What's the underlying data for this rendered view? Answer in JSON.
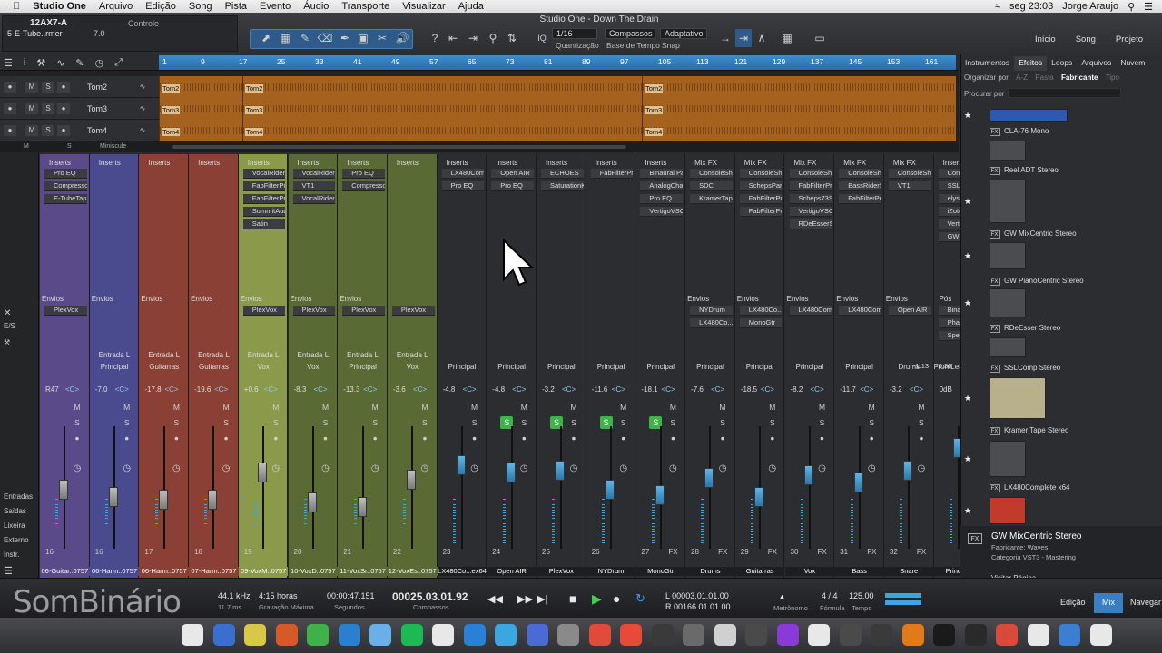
{
  "menubar": {
    "app": "Studio One",
    "items": [
      "Arquivo",
      "Edição",
      "Song",
      "Pista",
      "Evento",
      "Áudio",
      "Transporte",
      "Visualizar",
      "Ajuda"
    ],
    "clock": "seg 23:03",
    "user": "Jorge Araujo"
  },
  "window_title": "Studio One - Down The Drain",
  "instrument": {
    "name": "12AX7-A",
    "preset": "5-E-Tube..rmer",
    "value": "7.0",
    "control_label": "Controle"
  },
  "toolbar": {
    "quantize_value": "1/16",
    "quantize_label": "Quantização",
    "timebase_value": "Compassos",
    "timebase_label": "Base de Tempo",
    "snap_value": "Adaptativo",
    "snap_label": "Snap",
    "iq": "IQ"
  },
  "top_nav": [
    "Início",
    "Song",
    "Projeto"
  ],
  "ruler_ticks": [
    "1",
    "9",
    "17",
    "25",
    "33",
    "41",
    "49",
    "57",
    "65",
    "73",
    "81",
    "89",
    "97",
    "105",
    "113",
    "121",
    "129",
    "137",
    "145",
    "153",
    "161"
  ],
  "tracks": [
    {
      "name": "Tom2",
      "m": "M",
      "s": "S",
      "clips": [
        "Tom2",
        "Tom2",
        "Tom2"
      ]
    },
    {
      "name": "Tom3",
      "m": "M",
      "s": "S",
      "clips": [
        "Tom3",
        "Tom3",
        "Tom3"
      ]
    },
    {
      "name": "Tom4",
      "m": "M",
      "s": "S",
      "clips": [
        "Tom4",
        "Tom4",
        "Tom4"
      ]
    }
  ],
  "arranger_footer": {
    "m": "M",
    "s": "S",
    "miniscule": "Miniscule"
  },
  "mixer_left": {
    "es": "E/S",
    "items": [
      "Entradas",
      "Saídas",
      "Lixeira",
      "Externo",
      "Instr."
    ]
  },
  "inserts_label": "Inserts",
  "sends_label": "Envios",
  "mixfx_label": "Mix FX",
  "pos_label": "Pós",
  "strips": [
    {
      "route_in": "",
      "route_out": "",
      "vol": "R47",
      "name": "06-Guitar..0757",
      "num": "16",
      "color": "#5a4a8a",
      "inserts": [
        "Pro EQ",
        "Compressor",
        "E-TubeTap..."
      ],
      "sends": [
        "PlexVox"
      ]
    },
    {
      "route_in": "Entrada L",
      "route_out": "Principal",
      "vol": "-7.0",
      "name": "06-Harm..0757",
      "num": "16",
      "color": "#4a4a8e",
      "inserts": [],
      "sends": []
    },
    {
      "route_in": "Entrada L",
      "route_out": "Guitarras",
      "vol": "-17.8",
      "name": "06-Harm..0757",
      "num": "17",
      "color": "#8a4034",
      "inserts": [],
      "sends": []
    },
    {
      "route_in": "Entrada L",
      "route_out": "Guitarras",
      "vol": "-19.6",
      "name": "07-Harm..0757",
      "num": "18",
      "color": "#8a4034",
      "inserts": [],
      "sends": []
    },
    {
      "route_in": "Entrada L",
      "route_out": "Vox",
      "vol": "+0.6",
      "name": "09-VoxM..0757",
      "num": "19",
      "color": "#8a9a4a",
      "inserts": [
        "VocalRider...",
        "FabFilterPr...",
        "FabFilterPr...",
        "SummitAud...",
        "Satin"
      ],
      "sends": [
        "PlexVox"
      ]
    },
    {
      "route_in": "Entrada L",
      "route_out": "Vox",
      "vol": "-8.3",
      "name": "10-VoxD..0757",
      "num": "20",
      "color": "#5a6a34",
      "inserts": [
        "VocalRider...",
        "VT1",
        "VocalRider..."
      ],
      "sends": [
        "PlexVox"
      ]
    },
    {
      "route_in": "Entrada L",
      "route_out": "Principal",
      "vol": "-13.3",
      "name": "11-VoxSr..0757",
      "num": "21",
      "color": "#5a6a34",
      "inserts": [
        "Pro EQ",
        "Compressor"
      ],
      "sends": [
        "PlexVox"
      ]
    },
    {
      "route_in": "Entrada L",
      "route_out": "Vox",
      "vol": "-3.6",
      "name": "12-VoxEs..0757",
      "num": "22",
      "color": "#5a6a34",
      "inserts": [],
      "sends": [
        "PlexVox"
      ]
    },
    {
      "route_in": "",
      "route_out": "Principal",
      "vol": "-4.8",
      "name": "LX480Co...ex64",
      "num": "23",
      "color": "#2a2b2d",
      "inserts": [
        "LX480Com...",
        "Pro EQ"
      ],
      "sends": []
    },
    {
      "route_in": "",
      "route_out": "Principal",
      "vol": "-4.8",
      "name": "Open AIR",
      "num": "24",
      "color": "#2a2b2d",
      "inserts": [
        "Open AIR",
        "Pro EQ"
      ],
      "sends": []
    },
    {
      "route_in": "",
      "route_out": "Principal",
      "vol": "-3.2",
      "name": "PlexVox",
      "num": "25",
      "color": "#2a2b2d",
      "inserts": [
        "ECHOES",
        "SaturationK..."
      ],
      "sends": []
    },
    {
      "route_in": "",
      "route_out": "Principal",
      "vol": "-11.6",
      "name": "NYDrum",
      "num": "26",
      "color": "#2a2b2d",
      "inserts": [
        "FabFilterPr..."
      ],
      "sends": []
    },
    {
      "route_in": "",
      "route_out": "Principal",
      "vol": "-18.1",
      "name": "MonoGtr",
      "num": "27",
      "color": "#2a2b2d",
      "inserts": [
        "Binaural Pan",
        "AnalogCha...",
        "Pro EQ",
        "VertigoVSC..."
      ],
      "sends": []
    },
    {
      "route_in": "",
      "route_out": "Principal",
      "vol": "-7.6",
      "name": "Drums",
      "num": "28",
      "color": "#2a2b2d",
      "inserts": [
        "ConsoleShaper",
        "SDC",
        "KramerTap..."
      ],
      "sends": [
        "NYDrum",
        "LX480Co..."
      ]
    },
    {
      "route_in": "",
      "route_out": "Principal",
      "vol": "-18.5",
      "name": "Guitarras",
      "num": "29",
      "color": "#2a2b2d",
      "inserts": [
        "ConsoleShaper",
        "SchepsPar...",
        "FabFilterPr...",
        "FabFilterPr..."
      ],
      "sends": [
        "LX480Co...",
        "MonoGtr"
      ]
    },
    {
      "route_in": "",
      "route_out": "Principal",
      "vol": "-8.2",
      "name": "Vox",
      "num": "30",
      "color": "#2a2b2d",
      "inserts": [
        "ConsoleShaper",
        "FabFilterPr...",
        "Scheps73S...",
        "VertigoVSC...",
        "RDeEsserS..."
      ],
      "sends": [
        "LX480Com..."
      ]
    },
    {
      "route_in": "",
      "route_out": "Principal",
      "vol": "-11.7",
      "name": "Bass",
      "num": "31",
      "color": "#2a2b2d",
      "inserts": [
        "ConsoleShaper",
        "BassRiderS...",
        "FabFilterPr..."
      ],
      "sends": [
        "LX480Com..."
      ]
    },
    {
      "route_in": "",
      "route_out": "Drums",
      "vol": "-3.2",
      "name": "Snare",
      "num": "32",
      "color": "#2a2b2d",
      "inserts": [
        "ConsoleShaper",
        "VT1"
      ],
      "sends": [
        "Open AIR"
      ]
    },
    {
      "route_in": "",
      "route_out": "FrontLeft..Right",
      "vol": "0dB",
      "name": "Principal",
      "num": "",
      "color": "#2a2b2d",
      "inserts": [
        "ConsoleShaper",
        "SSLComp St...",
        "elysiamuse...",
        "iZotopeOz...",
        "VertigoVSC...",
        "GWMixCen..."
      ],
      "sends": [
        "BinauralP...",
        "PhaseMet...",
        "Spectrum..."
      ]
    }
  ],
  "master_readout": {
    "left": "-1.13",
    "right": "-0.30"
  },
  "browser": {
    "tabs": [
      "Instrumentos",
      "Efeitos",
      "Loops",
      "Arquivos",
      "Nuvem"
    ],
    "active_tab": "Efeitos",
    "organize_label": "Organizar por",
    "organize_options": [
      "A-Z",
      "Pasta",
      "Fabricante",
      "Tipo"
    ],
    "search_label": "Procurar por",
    "items": [
      "CLA-76 Mono",
      "Reel ADT Stereo",
      "GW MixCentric Stereo",
      "GW PianoCentric Stereo",
      "RDeEsser Stereo",
      "SSLComp Stereo",
      "Kramer Tape Stereo",
      "LX480Complete x64"
    ],
    "info_title": "GW MixCentric Stereo",
    "info_maker": "Fabricante: Waves",
    "info_category": "Categoria  VST3 - Mastering",
    "visit": "Visitar Página"
  },
  "transport": {
    "sample_rate": "44.1 kHz",
    "latency": "11.7 ms",
    "rec_time": "4:15 horas",
    "rec_label": "Gravação Máxima",
    "seconds": "00:00:47.151",
    "seconds_label": "Segundos",
    "bars": "00025.03.01.92",
    "bars_label": "Compassos",
    "loop_l": "L  00003.01.01.00",
    "loop_r": "R  00166.01.01.00",
    "metronome_label": "Metrônomo",
    "signature": "4 / 4",
    "signature_label": "Fórmula",
    "tempo": "125.00",
    "tempo_label": "Tempo"
  },
  "bottom_nav": [
    "Edição",
    "Mix",
    "Navegar"
  ],
  "bottom_nav_active": "Mix",
  "watermark": "SomBinário"
}
